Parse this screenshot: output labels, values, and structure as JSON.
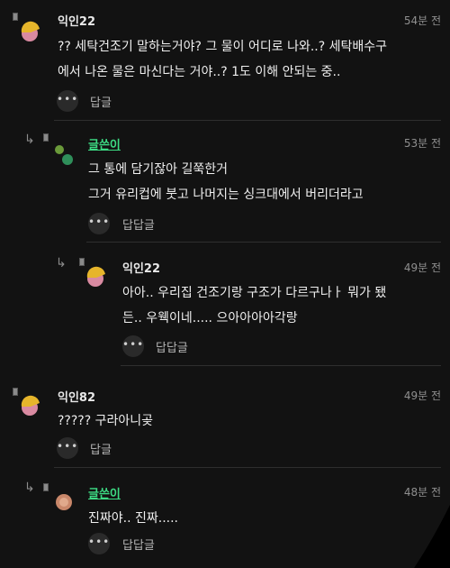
{
  "comments": [
    {
      "author": "익인22",
      "time": "54분 전",
      "body": "?? 세탁건조기 말하는거야? 그 물이 어디로 나와..? 세탁배수구\n에서 나온 물은 마신다는 거야..? 1도 이해 안되는 중..",
      "reply_label": "답글",
      "more_label": "•••"
    },
    {
      "author": "글쓴이",
      "time": "53분 전",
      "body": "그 통에 담기잖아 길쭉한거\n그거 유리컵에 붓고 나머지는 싱크대에서 버리더라고",
      "reply_label": "답답글",
      "more_label": "•••"
    },
    {
      "author": "익인22",
      "time": "49분 전",
      "body": "아아.. 우리집 건조기랑 구조가 다르구나ㅏ 뭐가 됐\n든.. 우웩이네..... 으아아아아각랑",
      "reply_label": "답답글",
      "more_label": "•••"
    },
    {
      "author": "익인82",
      "time": "49분 전",
      "body": "????? 구라아니곶",
      "reply_label": "답글",
      "more_label": "•••"
    },
    {
      "author": "글쓴이",
      "time": "48분 전",
      "body": "진짜야.. 진짜.....",
      "reply_label": "답답글",
      "more_label": "•••"
    }
  ],
  "colors": {
    "writer_name": "#3ddc84",
    "background": "#121212"
  },
  "icons": {
    "reply_indicator": "reply-arrow-icon",
    "badge": "badge-icon",
    "more": "more-dots-icon"
  }
}
